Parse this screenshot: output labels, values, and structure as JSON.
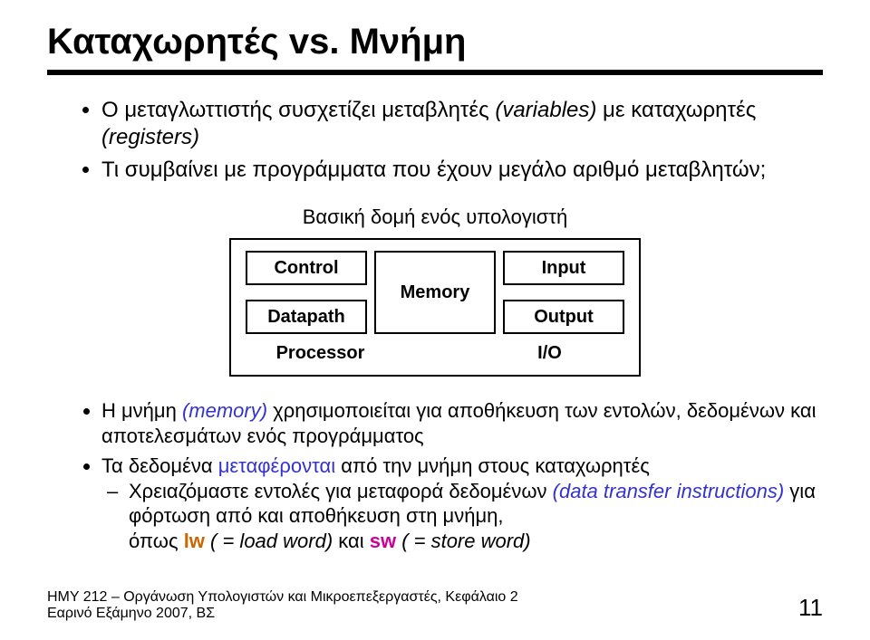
{
  "title": "Καταχωρητές vs. Μνήμη",
  "bullets": {
    "b1a": "Ο μεταγλωττιστής συσχετίζει μεταβλητές ",
    "b1b": "(variables)",
    "b1c": " με καταχωρητές ",
    "b1d": "(registers)",
    "b2": "Τι συμβαίνει με προγράμματα που έχουν μεγάλο αριθμό μεταβλητών;"
  },
  "diagram": {
    "caption": "Βασική δομή ενός υπολογιστή",
    "control": "Control",
    "datapath": "Datapath",
    "memory": "Memory",
    "input": "Input",
    "output": "Output",
    "proc": "Processor",
    "io": "I/O"
  },
  "lower": {
    "l1a": "Η μνήμη ",
    "l1b": "(memory)",
    "l1c": " χρησιμοποιείται για αποθήκευση των εντολών, δεδομένων και αποτελεσμάτων ενός προγράμματος",
    "l2a": "Τα δεδομένα ",
    "l2b": "μεταφέρονται",
    "l2c": " από την μνήμη στους καταχωρητές",
    "l3a": "Χρειαζόμαστε εντολές για μεταφορά δεδομένων ",
    "l3b": "(data transfer instructions)",
    "l3c": " για φόρτωση από και αποθήκευση στη μνήμη,",
    "l4a": "όπως ",
    "l4b": "lw",
    "l4c": " ( = load word)",
    "l4d": " και ",
    "l4e": "sw",
    "l4f": " ( = store word)"
  },
  "footer": {
    "course": "ΗΜΥ 212 – Οργάνωση Υπολογιστών και Μικροεπεξεργαστές, Κεφάλαιο 2",
    "sem": "Εαρινό Εξάμηνο 2007, ΒΣ",
    "page": "11"
  }
}
